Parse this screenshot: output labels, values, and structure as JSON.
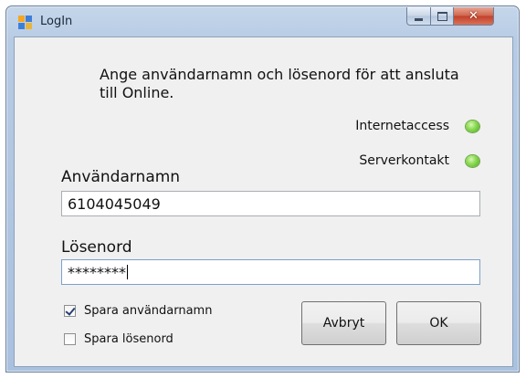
{
  "window": {
    "title": "LogIn",
    "controls": {
      "minimize": "minimize-icon",
      "maximize": "maximize-icon",
      "close": "close-icon"
    }
  },
  "instruction": "Ange användarnamn och lösenord för att ansluta till Online.",
  "status": {
    "internet_label": "Internetaccess",
    "internet_color": "#7ed348",
    "server_label": "Serverkontakt",
    "server_color": "#7ed348"
  },
  "username": {
    "label": "Användarnamn",
    "value": "6104045049"
  },
  "password": {
    "label": "Lösenord",
    "value": "********"
  },
  "options": {
    "save_username": {
      "label": "Spara användarnamn",
      "checked": true
    },
    "save_password": {
      "label": "Spara lösenord",
      "checked": false
    }
  },
  "buttons": {
    "cancel": "Avbryt",
    "ok": "OK"
  }
}
